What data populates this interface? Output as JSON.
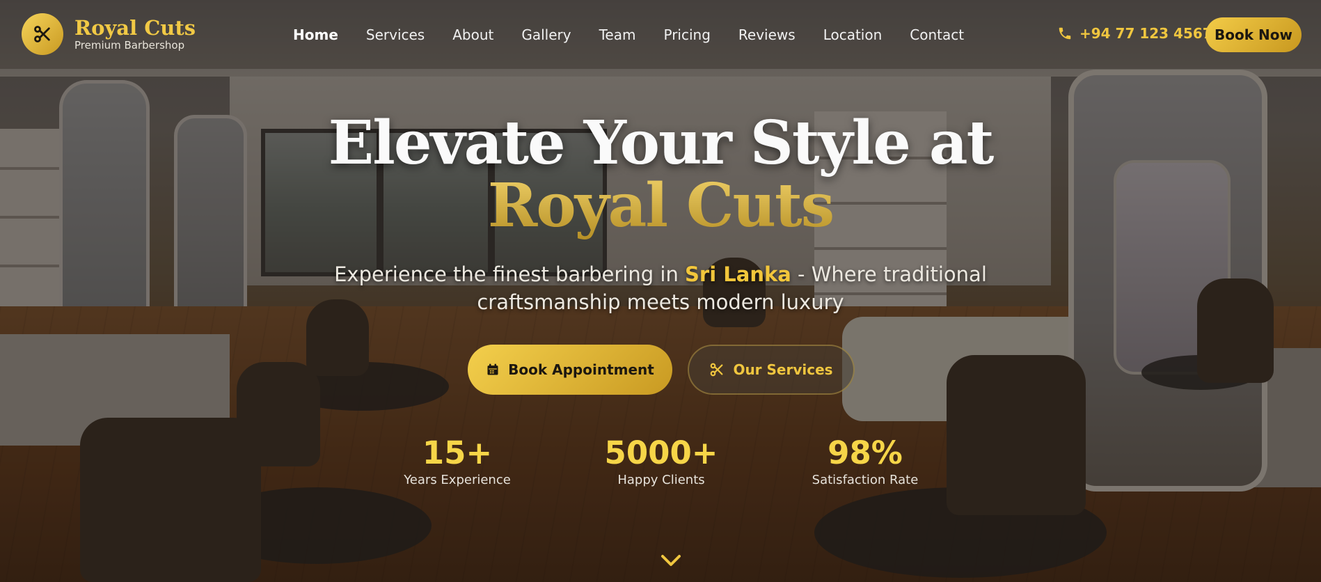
{
  "header": {
    "brand": "Royal Cuts",
    "tagline": "Premium Barbershop",
    "logo_icon": "scissors-icon",
    "nav": [
      {
        "label": "Home",
        "active": true
      },
      {
        "label": "Services"
      },
      {
        "label": "About"
      },
      {
        "label": "Gallery"
      },
      {
        "label": "Team"
      },
      {
        "label": "Pricing"
      },
      {
        "label": "Reviews"
      },
      {
        "label": "Location"
      },
      {
        "label": "Contact"
      }
    ],
    "phone": "+94 77 123 4567",
    "phone_icon": "phone-icon",
    "book_now": "Book Now"
  },
  "hero": {
    "title_line1": "Elevate Your Style at",
    "title_line2": "Royal Cuts",
    "subtitle_before": "Experience the finest barbering in ",
    "subtitle_highlight": "Sri Lanka",
    "subtitle_after": " - Where traditional craftsmanship meets modern luxury",
    "primary_button": "Book Appointment",
    "primary_icon": "calendar-icon",
    "secondary_button": "Our Services",
    "secondary_icon": "scissors-icon",
    "stats": [
      {
        "value": "15+",
        "label": "Years Experience"
      },
      {
        "value": "5000+",
        "label": "Happy Clients"
      },
      {
        "value": "98%",
        "label": "Satisfaction Rate"
      }
    ],
    "scroll_icon": "chevron-down-icon"
  },
  "colors": {
    "accent": "#f1c945",
    "accent_dark": "#c99a22",
    "text_light": "#ece8e0"
  }
}
